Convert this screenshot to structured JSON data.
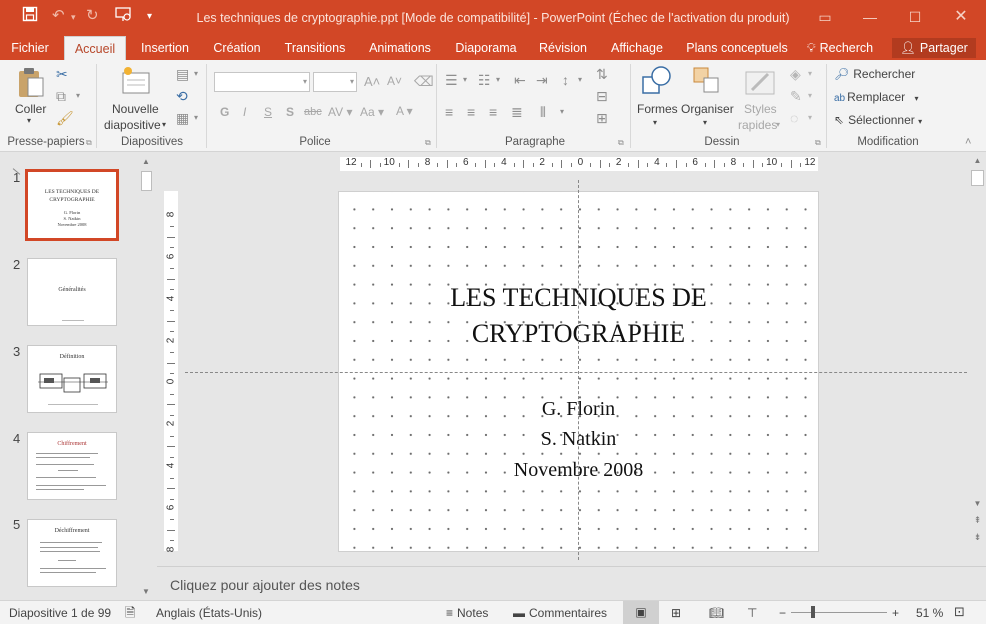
{
  "window": {
    "title": "Les techniques de cryptographie.ppt [Mode de compatibilité] - PowerPoint (Échec de l'activation du produit)"
  },
  "tabs": [
    {
      "label": "Fichier"
    },
    {
      "label": "Accueil"
    },
    {
      "label": "Insertion"
    },
    {
      "label": "Création"
    },
    {
      "label": "Transitions"
    },
    {
      "label": "Animations"
    },
    {
      "label": "Diaporama"
    },
    {
      "label": "Révision"
    },
    {
      "label": "Affichage"
    },
    {
      "label": "Plans conceptuels"
    }
  ],
  "tell_me": "Recherch",
  "share": "Partager",
  "ribbon": {
    "coller": "Coller",
    "nouvelle": "Nouvelle",
    "diapositive": "diapositive",
    "formes": "Formes",
    "organiser": "Organiser",
    "styles": "Styles",
    "rapides": "rapides",
    "rechercher": "Rechercher",
    "remplacer": "Remplacer",
    "selectionner": "Sélectionner",
    "groups": {
      "presse_papiers": "Presse-papiers",
      "diapositives": "Diapositives",
      "police": "Police",
      "paragraphe": "Paragraphe",
      "dessin": "Dessin",
      "modification": "Modification"
    }
  },
  "ruler": {
    "h_labels": [
      "12",
      "10",
      "8",
      "6",
      "4",
      "2",
      "0",
      "2",
      "4",
      "6",
      "8",
      "10",
      "12"
    ],
    "v_labels": [
      "8",
      "6",
      "4",
      "2",
      "0",
      "2",
      "4",
      "6",
      "8"
    ]
  },
  "thumbnails": [
    {
      "num": "1",
      "title": "LES TECHNIQUES DE CRYPTOGRAPHIE",
      "sub1": "G. Florin",
      "sub2": "S. Natkin",
      "sub3": "Novembre 2008"
    },
    {
      "num": "2",
      "title": "Généralités"
    },
    {
      "num": "3",
      "title": "Définition"
    },
    {
      "num": "4",
      "title": "Chiffrement"
    },
    {
      "num": "5",
      "title": "Déchiffrement"
    }
  ],
  "slide": {
    "title_line1": "LES TECHNIQUES DE",
    "title_line2": "CRYPTOGRAPHIE",
    "author1": "G. Florin",
    "author2": "S. Natkin",
    "date": "Novembre 2008"
  },
  "notes_placeholder": "Cliquez pour ajouter des notes",
  "status": {
    "slide_count": "Diapositive 1 de 99",
    "language": "Anglais (États-Unis)",
    "notes": "Notes",
    "comments": "Commentaires",
    "zoom": "51 %"
  },
  "colors": {
    "accent": "#d24726",
    "ribbon_bg": "#f3f3f3"
  }
}
